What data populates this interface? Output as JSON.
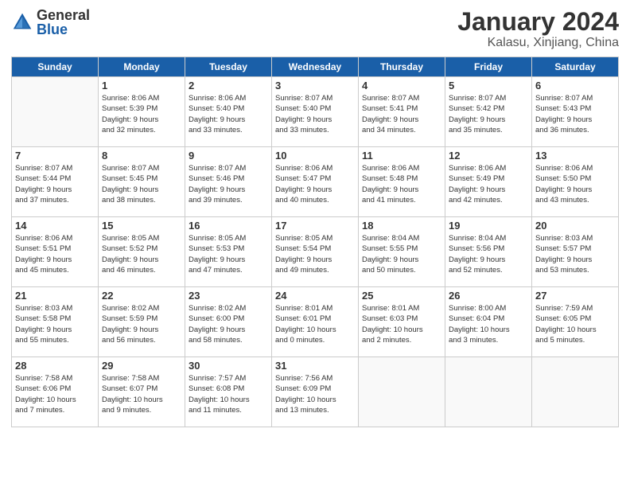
{
  "header": {
    "logo_general": "General",
    "logo_blue": "Blue",
    "month_title": "January 2024",
    "location": "Kalasu, Xinjiang, China"
  },
  "weekdays": [
    "Sunday",
    "Monday",
    "Tuesday",
    "Wednesday",
    "Thursday",
    "Friday",
    "Saturday"
  ],
  "weeks": [
    [
      {
        "day": "",
        "info": ""
      },
      {
        "day": "1",
        "info": "Sunrise: 8:06 AM\nSunset: 5:39 PM\nDaylight: 9 hours\nand 32 minutes."
      },
      {
        "day": "2",
        "info": "Sunrise: 8:06 AM\nSunset: 5:40 PM\nDaylight: 9 hours\nand 33 minutes."
      },
      {
        "day": "3",
        "info": "Sunrise: 8:07 AM\nSunset: 5:40 PM\nDaylight: 9 hours\nand 33 minutes."
      },
      {
        "day": "4",
        "info": "Sunrise: 8:07 AM\nSunset: 5:41 PM\nDaylight: 9 hours\nand 34 minutes."
      },
      {
        "day": "5",
        "info": "Sunrise: 8:07 AM\nSunset: 5:42 PM\nDaylight: 9 hours\nand 35 minutes."
      },
      {
        "day": "6",
        "info": "Sunrise: 8:07 AM\nSunset: 5:43 PM\nDaylight: 9 hours\nand 36 minutes."
      }
    ],
    [
      {
        "day": "7",
        "info": "Sunrise: 8:07 AM\nSunset: 5:44 PM\nDaylight: 9 hours\nand 37 minutes."
      },
      {
        "day": "8",
        "info": "Sunrise: 8:07 AM\nSunset: 5:45 PM\nDaylight: 9 hours\nand 38 minutes."
      },
      {
        "day": "9",
        "info": "Sunrise: 8:07 AM\nSunset: 5:46 PM\nDaylight: 9 hours\nand 39 minutes."
      },
      {
        "day": "10",
        "info": "Sunrise: 8:06 AM\nSunset: 5:47 PM\nDaylight: 9 hours\nand 40 minutes."
      },
      {
        "day": "11",
        "info": "Sunrise: 8:06 AM\nSunset: 5:48 PM\nDaylight: 9 hours\nand 41 minutes."
      },
      {
        "day": "12",
        "info": "Sunrise: 8:06 AM\nSunset: 5:49 PM\nDaylight: 9 hours\nand 42 minutes."
      },
      {
        "day": "13",
        "info": "Sunrise: 8:06 AM\nSunset: 5:50 PM\nDaylight: 9 hours\nand 43 minutes."
      }
    ],
    [
      {
        "day": "14",
        "info": "Sunrise: 8:06 AM\nSunset: 5:51 PM\nDaylight: 9 hours\nand 45 minutes."
      },
      {
        "day": "15",
        "info": "Sunrise: 8:05 AM\nSunset: 5:52 PM\nDaylight: 9 hours\nand 46 minutes."
      },
      {
        "day": "16",
        "info": "Sunrise: 8:05 AM\nSunset: 5:53 PM\nDaylight: 9 hours\nand 47 minutes."
      },
      {
        "day": "17",
        "info": "Sunrise: 8:05 AM\nSunset: 5:54 PM\nDaylight: 9 hours\nand 49 minutes."
      },
      {
        "day": "18",
        "info": "Sunrise: 8:04 AM\nSunset: 5:55 PM\nDaylight: 9 hours\nand 50 minutes."
      },
      {
        "day": "19",
        "info": "Sunrise: 8:04 AM\nSunset: 5:56 PM\nDaylight: 9 hours\nand 52 minutes."
      },
      {
        "day": "20",
        "info": "Sunrise: 8:03 AM\nSunset: 5:57 PM\nDaylight: 9 hours\nand 53 minutes."
      }
    ],
    [
      {
        "day": "21",
        "info": "Sunrise: 8:03 AM\nSunset: 5:58 PM\nDaylight: 9 hours\nand 55 minutes."
      },
      {
        "day": "22",
        "info": "Sunrise: 8:02 AM\nSunset: 5:59 PM\nDaylight: 9 hours\nand 56 minutes."
      },
      {
        "day": "23",
        "info": "Sunrise: 8:02 AM\nSunset: 6:00 PM\nDaylight: 9 hours\nand 58 minutes."
      },
      {
        "day": "24",
        "info": "Sunrise: 8:01 AM\nSunset: 6:01 PM\nDaylight: 10 hours\nand 0 minutes."
      },
      {
        "day": "25",
        "info": "Sunrise: 8:01 AM\nSunset: 6:03 PM\nDaylight: 10 hours\nand 2 minutes."
      },
      {
        "day": "26",
        "info": "Sunrise: 8:00 AM\nSunset: 6:04 PM\nDaylight: 10 hours\nand 3 minutes."
      },
      {
        "day": "27",
        "info": "Sunrise: 7:59 AM\nSunset: 6:05 PM\nDaylight: 10 hours\nand 5 minutes."
      }
    ],
    [
      {
        "day": "28",
        "info": "Sunrise: 7:58 AM\nSunset: 6:06 PM\nDaylight: 10 hours\nand 7 minutes."
      },
      {
        "day": "29",
        "info": "Sunrise: 7:58 AM\nSunset: 6:07 PM\nDaylight: 10 hours\nand 9 minutes."
      },
      {
        "day": "30",
        "info": "Sunrise: 7:57 AM\nSunset: 6:08 PM\nDaylight: 10 hours\nand 11 minutes."
      },
      {
        "day": "31",
        "info": "Sunrise: 7:56 AM\nSunset: 6:09 PM\nDaylight: 10 hours\nand 13 minutes."
      },
      {
        "day": "",
        "info": ""
      },
      {
        "day": "",
        "info": ""
      },
      {
        "day": "",
        "info": ""
      }
    ]
  ]
}
